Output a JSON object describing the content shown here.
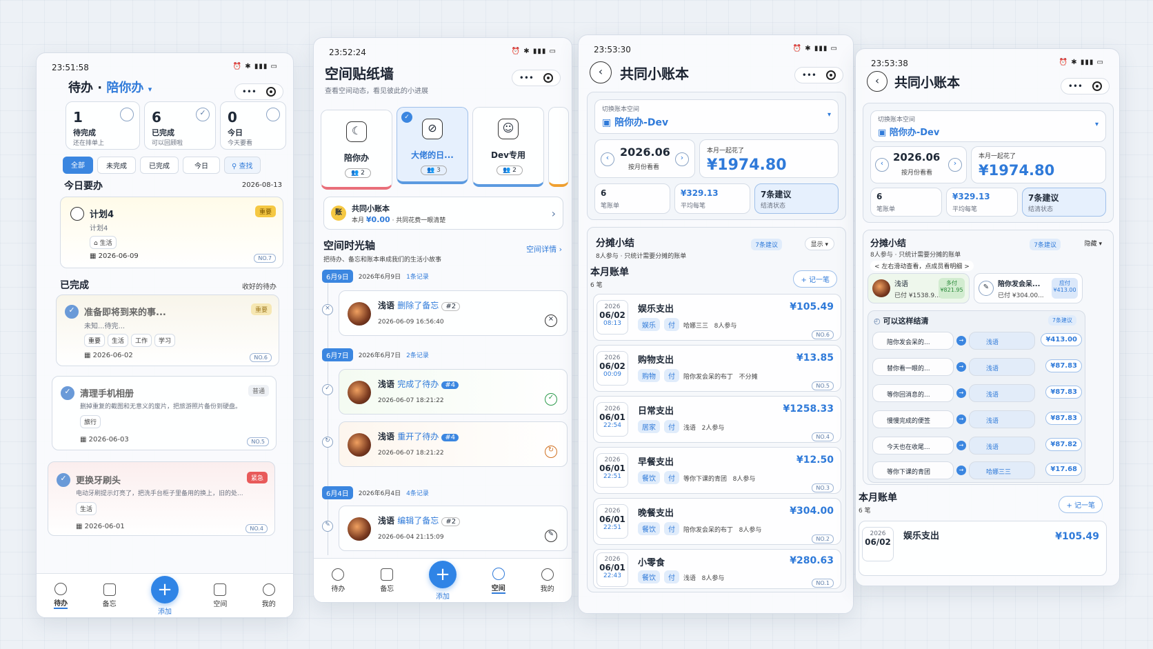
{
  "p1": {
    "time": "23:51:58",
    "title": "待办",
    "title_sep": "·",
    "space_name": "陪你办",
    "stats": [
      {
        "num": "1",
        "label": "待完成",
        "sub": "还在排单上"
      },
      {
        "num": "6",
        "label": "已完成",
        "sub": "可以回顾啦"
      },
      {
        "num": "0",
        "label": "今日",
        "sub": "今天要看"
      }
    ],
    "filters": [
      "全部",
      "未完成",
      "已完成",
      "今日",
      "查找"
    ],
    "today_title": "今日要办",
    "today_date": "2026-08-13",
    "task": {
      "name": "计划4",
      "desc": "计划4",
      "tag": "生活",
      "date": "2026-06-09",
      "badge": "重要",
      "no": "NO.7"
    },
    "done_title": "已完成",
    "done_action": "收好的待办",
    "done": [
      {
        "name": "准备即将到来的事...",
        "desc": "未知...待完...",
        "tags": [
          "重要",
          "生活",
          "工作",
          "学习"
        ],
        "date": "2026-06-02",
        "badge": "重要",
        "no": "NO.6"
      },
      {
        "name": "清理手机相册",
        "desc": "删掉重复的截图和无意义的废片，把旅游照片备份到硬盘。",
        "tags": [
          "旅行"
        ],
        "date": "2026-06-03",
        "badge": "普通",
        "no": "NO.5"
      },
      {
        "name": "更换牙刷头",
        "desc": "电动牙刷提示灯亮了，把洗手台柜子里备用的换上，旧的处...",
        "tags": [
          "生活"
        ],
        "date": "2026-06-01",
        "badge": "紧急",
        "no": "NO.4"
      }
    ],
    "tabs": [
      "待办",
      "备忘",
      "添加",
      "空间",
      "我的"
    ]
  },
  "p2": {
    "time": "23:52:24",
    "title": "空间贴纸墙",
    "subtitle": "查看空间动态，看见彼此的小进展",
    "spaces": [
      {
        "name": "陪你办",
        "count": "2"
      },
      {
        "name": "大佬的日...",
        "count": "3"
      },
      {
        "name": "Dev专用",
        "count": "2"
      }
    ],
    "ledger_badge": "账",
    "ledger_name": "共同小账本",
    "ledger_month": "本月",
    "ledger_amount": "¥0.00",
    "ledger_note": "· 共同花费一眼清楚",
    "timeline_title": "空间时光轴",
    "timeline_sub": "把待办、备忘和账本串成我们的生活小故事",
    "timeline_link": "空间详情",
    "groups": [
      {
        "label": "6月9日",
        "date": "2026年6月9日",
        "count": "1条记录",
        "items": [
          {
            "user": "浅语",
            "action": "删除了备忘",
            "tag": "#2",
            "time": "2026-06-09 16:56:40",
            "mark": "×"
          }
        ]
      },
      {
        "label": "6月7日",
        "date": "2026年6月7日",
        "count": "2条记录",
        "items": [
          {
            "user": "浅语",
            "action": "完成了待办",
            "tag": "#4",
            "time": "2026-06-07 18:21:22",
            "mark": "✓"
          },
          {
            "user": "浅语",
            "action": "重开了待办",
            "tag": "#4",
            "time": "2026-06-07 18:21:22",
            "mark": "↻"
          }
        ]
      },
      {
        "label": "6月4日",
        "date": "2026年6月4日",
        "count": "4条记录",
        "items": [
          {
            "user": "浅语",
            "action": "编辑了备忘",
            "tag": "#2",
            "time": "2026-06-04 21:15:09",
            "mark": "✎"
          }
        ]
      }
    ],
    "tabs": [
      "待办",
      "备忘",
      "添加",
      "空间",
      "我的"
    ]
  },
  "p3": {
    "time": "23:53:30",
    "title": "共同小账本",
    "switch_label": "切换账本空间",
    "space": "陪你办-Dev",
    "month": "2026.06",
    "month_sub": "按月份看看",
    "spent_label": "本月一起花了",
    "spent": "¥1974.80",
    "stats": [
      {
        "num": "6",
        "label": "笔账单"
      },
      {
        "num": "¥329.13",
        "label": "平均每笔"
      },
      {
        "num": "7条建议",
        "label": "结清状态"
      }
    ],
    "split_title": "分摊小结",
    "split_sub": "8人参与 · 只统计需要分摊的账单",
    "split_badge": "7条建议",
    "split_toggle": "显示",
    "bills_title": "本月账单",
    "bills_count": "6 笔",
    "add_btn": "+ 记一笔",
    "bills": [
      {
        "year": "2026",
        "md": "06/02",
        "hm": "08:13",
        "name": "娱乐支出",
        "amount": "¥105.49",
        "cat": "娱乐",
        "pay": "付",
        "payer": "哈娜三三",
        "people": "8人参与",
        "no": "NO.6"
      },
      {
        "year": "2026",
        "md": "06/02",
        "hm": "00:09",
        "name": "购物支出",
        "amount": "¥13.85",
        "cat": "购物",
        "pay": "付",
        "payer": "陪你发会呆的布丁",
        "people": "不分摊",
        "no": "NO.5"
      },
      {
        "year": "2026",
        "md": "06/01",
        "hm": "22:54",
        "name": "日常支出",
        "amount": "¥1258.33",
        "cat": "居家",
        "pay": "付",
        "payer": "浅语",
        "people": "2人参与",
        "no": "NO.4"
      },
      {
        "year": "2026",
        "md": "06/01",
        "hm": "22:51",
        "name": "早餐支出",
        "amount": "¥12.50",
        "cat": "餐饮",
        "pay": "付",
        "payer": "等你下课的青团",
        "people": "8人参与",
        "no": "NO.3"
      },
      {
        "year": "2026",
        "md": "06/01",
        "hm": "22:51",
        "name": "晚餐支出",
        "amount": "¥304.00",
        "cat": "餐饮",
        "pay": "付",
        "payer": "陪你发会呆的布丁",
        "people": "8人参与",
        "no": "NO.2"
      },
      {
        "year": "2026",
        "md": "06/01",
        "hm": "22:43",
        "name": "小零食",
        "amount": "¥280.63",
        "cat": "餐饮",
        "pay": "付",
        "payer": "浅语",
        "people": "8人参与",
        "no": "NO.1"
      }
    ]
  },
  "p4": {
    "time": "23:53:38",
    "title": "共同小账本",
    "switch_label": "切换账本空间",
    "space": "陪你办-Dev",
    "month": "2026.06",
    "month_sub": "按月份看看",
    "spent_label": "本月一起花了",
    "spent": "¥1974.80",
    "stats": [
      {
        "num": "6",
        "label": "笔账单"
      },
      {
        "num": "¥329.13",
        "label": "平均每笔"
      },
      {
        "num": "7条建议",
        "label": "结清状态"
      }
    ],
    "split_title": "分摊小结",
    "split_sub": "8人参与 · 只统计需要分摊的账单",
    "split_badge": "7条建议",
    "split_toggle": "隐藏",
    "swipe_hint": "< 左右滑动查看，点成员看明细 >",
    "members": [
      {
        "name": "浅语",
        "paid": "已付 ¥1538.9...",
        "state": "多付",
        "value": "¥821.95"
      },
      {
        "name": "陪你发会呆...",
        "paid": "已付 ¥304.00...",
        "state": "应付",
        "value": "¥413.00"
      }
    ],
    "settle_title": "可以这样结清",
    "settle_badge": "7条建议",
    "settle": [
      {
        "from": "陪你发会呆的...",
        "to": "浅语",
        "amount": "¥413.00"
      },
      {
        "from": "替你看一眼的...",
        "to": "浅语",
        "amount": "¥87.83"
      },
      {
        "from": "等你回消息的...",
        "to": "浅语",
        "amount": "¥87.83"
      },
      {
        "from": "慢慢完成的便签",
        "to": "浅语",
        "amount": "¥87.83"
      },
      {
        "from": "今天也在收尾...",
        "to": "浅语",
        "amount": "¥87.82"
      },
      {
        "from": "等你下课的青团",
        "to": "哈娜三三",
        "amount": "¥17.68"
      }
    ],
    "bills_title": "本月账单",
    "bills_count": "6 笔",
    "add_btn": "+ 记一笔",
    "first_bill": {
      "year": "2026",
      "md": "06/02",
      "name": "娱乐支出",
      "amount": "¥105.49"
    }
  }
}
